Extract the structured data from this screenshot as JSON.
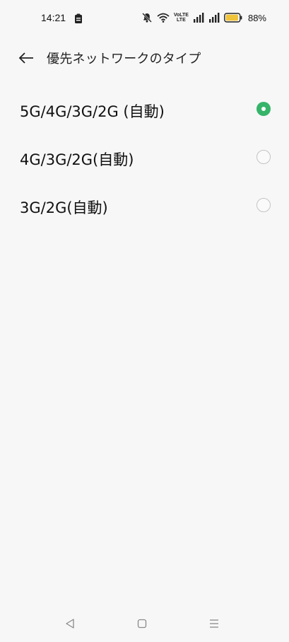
{
  "status_bar": {
    "time": "14:21",
    "volte_top": "VoLTE",
    "volte_bottom": "LTE",
    "battery_percent": "88%",
    "battery_color": "#f0c43a",
    "icons": [
      "clipboard-icon",
      "bell-muted-icon",
      "wifi-icon",
      "signal-icon",
      "battery-icon"
    ]
  },
  "header": {
    "title": "優先ネットワークのタイプ",
    "back_icon": "arrow-left-icon"
  },
  "options": [
    {
      "label": "5G/4G/3G/2G (自動)",
      "selected": true
    },
    {
      "label": "4G/3G/2G(自動)",
      "selected": false
    },
    {
      "label": "3G/2G(自動)",
      "selected": false
    }
  ],
  "accent_color": "#36b46a",
  "nav_bar": {
    "icons": [
      "nav-back-icon",
      "nav-home-icon",
      "nav-recents-icon"
    ]
  }
}
